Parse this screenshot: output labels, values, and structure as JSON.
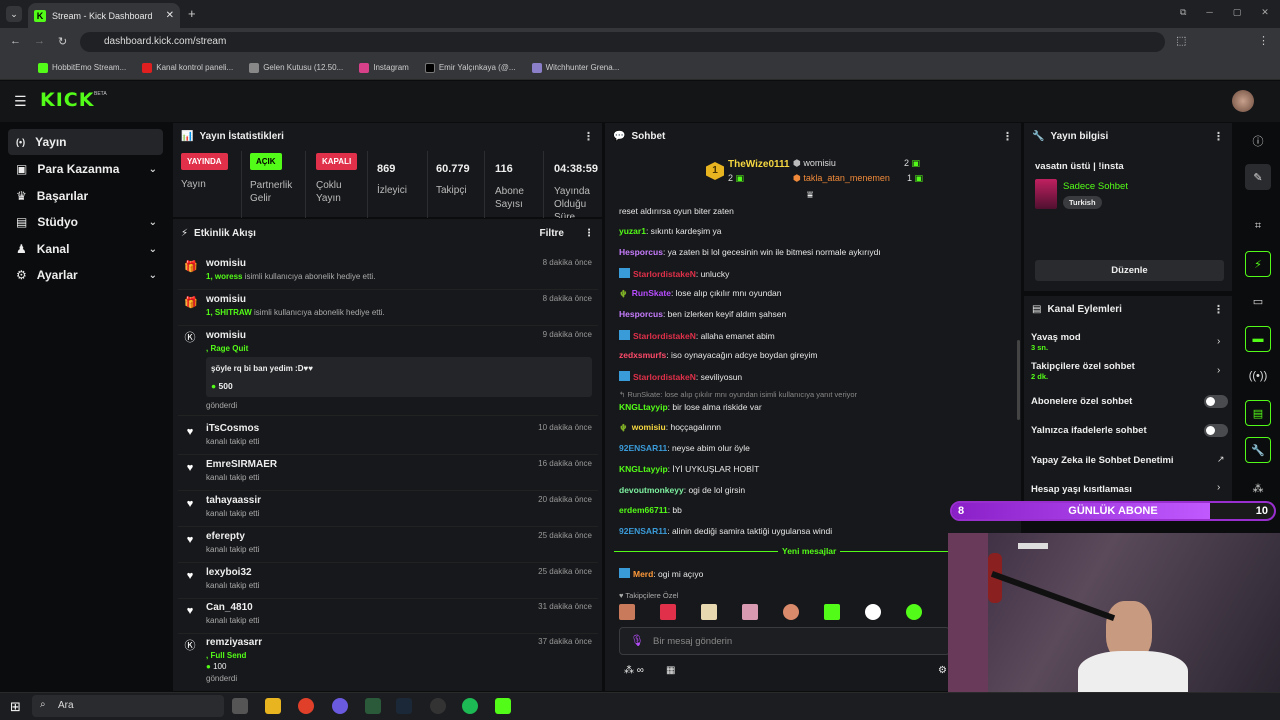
{
  "browser": {
    "tab_title": "Stream - Kick Dashboard",
    "url": "dashboard.kick.com/stream",
    "bookmarks": [
      "HobbitEmo Stream...",
      "Kanal kontrol paneli...",
      "Gelen Kutusu (12.50...",
      "Instagram",
      "Emir Yalçınkaya (@...",
      "Witchhunter Grena..."
    ]
  },
  "header": {
    "logo": "KICK",
    "beta": "BETA"
  },
  "nav": {
    "items": [
      {
        "label": "Yayın",
        "icon": "(•)"
      },
      {
        "label": "Para Kazanma",
        "icon": "▣",
        "chev": "⌄"
      },
      {
        "label": "Başarılar",
        "icon": "♛"
      },
      {
        "label": "Stüdyo",
        "icon": "▤",
        "chev": "⌄"
      },
      {
        "label": "Kanal",
        "icon": "♟",
        "chev": "⌄"
      },
      {
        "label": "Ayarlar",
        "icon": "⚙",
        "chev": "⌄"
      }
    ]
  },
  "stats": {
    "title": "Yayın İstatistikleri",
    "yayinda": "YAYINDA",
    "yayin": "Yayın",
    "acik": "AÇIK",
    "partner": "Partnerlik Gelir",
    "kapali": "KAPALI",
    "coklu": "Çoklu Yayın",
    "izleyici_val": "869",
    "izleyici": "İzleyici",
    "takipci_val": "60.779",
    "takipci": "Takipçi",
    "abone_val": "116",
    "abone": "Abone Sayısı",
    "sure_val": "04:38:59",
    "sure": "Yayında Olduğu Süre"
  },
  "activity": {
    "title": "Etkinlik Akışı",
    "filter": "Filtre",
    "items": [
      {
        "name": "womisiu",
        "sub_hl": "1, woress",
        "sub": " isimli kullanıcıya abonelik hediye etti.",
        "time": "8 dakika önce",
        "icon": "gift"
      },
      {
        "name": "womisiu",
        "sub_hl": "1, SHITRAW",
        "sub": " isimli kullanıcıya abonelik hediye etti.",
        "time": "8 dakika önce",
        "icon": "gift"
      },
      {
        "name": "womisiu",
        "sub_hl": ", Rage Quit",
        "msg": "şöyle rq bi ban yedim :D♥♥",
        "amount": "500",
        "sub2": "gönderdi",
        "time": "9 dakika önce",
        "icon": "k"
      },
      {
        "name": "iTsCosmos",
        "sub": "kanalı takip etti",
        "time": "10 dakika önce",
        "icon": "heart"
      },
      {
        "name": "EmreSIRMAER",
        "sub": "kanalı takip etti",
        "time": "16 dakika önce",
        "icon": "heart"
      },
      {
        "name": "tahayaassir",
        "sub": "kanalı takip etti",
        "time": "20 dakika önce",
        "icon": "heart"
      },
      {
        "name": "eferepty",
        "sub": "kanalı takip etti",
        "time": "25 dakika önce",
        "icon": "heart"
      },
      {
        "name": "lexyboi32",
        "sub": "kanalı takip etti",
        "time": "25 dakika önce",
        "icon": "heart"
      },
      {
        "name": "Can_4810",
        "sub": "kanalı takip etti",
        "time": "31 dakika önce",
        "icon": "heart"
      },
      {
        "name": "remziyasarr",
        "sub_hl": ", Full Send",
        "amount": "100",
        "sub2": "gönderdi",
        "time": "37 dakika önce",
        "icon": "k"
      }
    ]
  },
  "chat": {
    "title": "Sohbet",
    "top1_rank": "1",
    "top1_name": "TheWize0111",
    "top1_count": "2",
    "top2_name": "womisiu",
    "top2_count": "2",
    "top3_name": "takla_atan_menemen",
    "top3_count": "1",
    "messages": [
      {
        "user": "",
        "text": "reset aldırırsa oyun biter zaten",
        "color": "#e8e8e8"
      },
      {
        "user": "yuzar1",
        "text": "sıkıntı kardeşim ya",
        "color": "#53fc18"
      },
      {
        "user": "Hesporcus",
        "text": "ya zaten bi lol gecesinin win ile bitmesi normale aykırıydı",
        "color": "#c87dff"
      },
      {
        "user": "StarlordistakeN",
        "text": "unlucky",
        "color": "#e0304a",
        "badge": true
      },
      {
        "user": "RunSkate",
        "text": "lose alıp çıkılır mnı oyundan",
        "color": "#b84dff",
        "icon": "🌵"
      },
      {
        "user": "Hesporcus",
        "text": "ben izlerken keyif aldım şahsen",
        "color": "#c87dff"
      },
      {
        "user": "StarlordistakeN",
        "text": "allaha emanet abim",
        "color": "#e0304a",
        "badge": true
      },
      {
        "user": "zedxsmurfs",
        "text": "iso oynayacağın adcye boydan gireyim",
        "color": "#ff4a6a"
      },
      {
        "user": "StarlordistakeN",
        "text": "seviliyosun",
        "color": "#e0304a",
        "badge": true
      }
    ],
    "reply": "↰ RunSkate: lose alıp çıkılır mnı oyundan isimli kullanıcıya yanıt veriyor",
    "messages2": [
      {
        "user": "KNGLtayyip",
        "text": "bir lose alma riskide var",
        "color": "#53fc18"
      },
      {
        "user": "womisiu",
        "text": "hoççagalınnn",
        "color": "#f5d742",
        "icon": "🌵"
      },
      {
        "user": "92ENSAR11",
        "text": "neyse abim olur öyle",
        "color": "#3a9bd9"
      },
      {
        "user": "KNGLtayyip",
        "text": "İYİ UYKUŞLAR HOBİT",
        "color": "#53fc18"
      },
      {
        "user": "devoutmonkeyy",
        "text": "ogi de lol girsin",
        "color": "#7df0a0"
      },
      {
        "user": "erdem66711",
        "text": "bb",
        "color": "#53fc18"
      },
      {
        "user": "92ENSAR11",
        "text": "alinin dediği samira taktiği uygulansa windi",
        "color": "#3a9bd9"
      }
    ],
    "new_label": "Yeni mesajlar",
    "last": {
      "user": "Merd",
      "text": "ogi mi açıyo",
      "color": "#ff9a3a"
    },
    "followers_only": "Takipçilere Özel",
    "placeholder": "Bir mesaj gönderin"
  },
  "info": {
    "title": "Yayın bilgisi",
    "stream_title": "vasatın üstü | !insta",
    "mode": "Sadece Sohbet",
    "lang": "Turkish",
    "edit": "Düzenle"
  },
  "actions": {
    "title": "Kanal Eylemleri",
    "slow": "Yavaş mod",
    "slow_val": "3 sn.",
    "followers": "Takipçilere özel sohbet",
    "followers_val": "2 dk.",
    "subs": "Abonelere özel sohbet",
    "emotes": "Yalnızca ifadelerle sohbet",
    "ai": "Yapay Zeka ile Sohbet Denetimi",
    "age": "Hesap yaşı kısıtlaması"
  },
  "overlay": {
    "left": "8",
    "label": "GÜNLÜK ABONE",
    "right": "10"
  },
  "taskbar": {
    "search": "Ara"
  }
}
